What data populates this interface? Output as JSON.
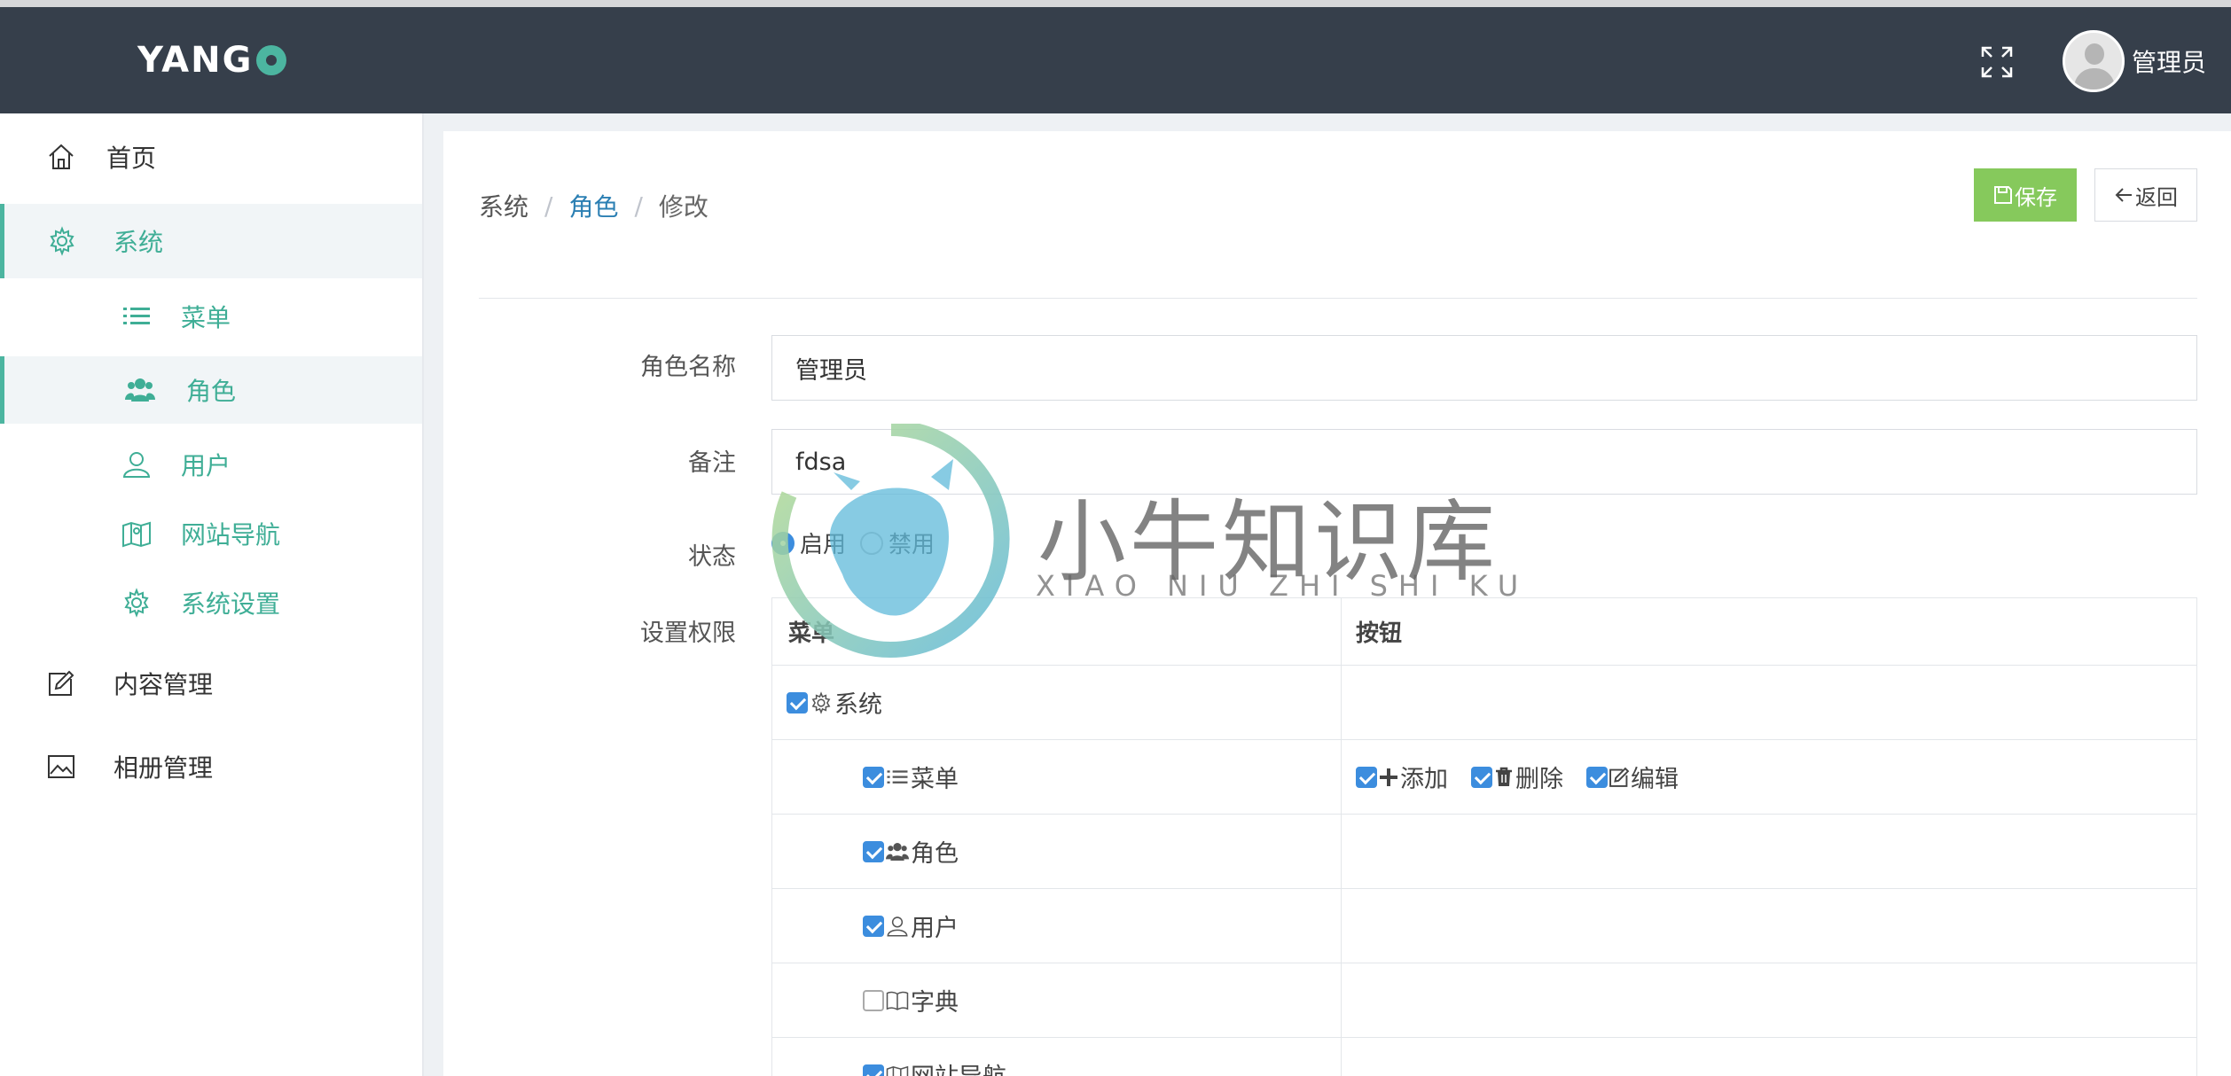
{
  "header": {
    "logo_text": "YANG",
    "user_name": "管理员"
  },
  "sidebar": {
    "items": [
      {
        "label": "首页",
        "icon": "home-icon"
      },
      {
        "label": "系统",
        "icon": "gear-icon"
      },
      {
        "label": "菜单",
        "icon": "list-icon"
      },
      {
        "label": "角色",
        "icon": "users-icon"
      },
      {
        "label": "用户",
        "icon": "user-icon"
      },
      {
        "label": "网站导航",
        "icon": "map-icon"
      },
      {
        "label": "系统设置",
        "icon": "gear-icon"
      },
      {
        "label": "内容管理",
        "icon": "edit-icon"
      },
      {
        "label": "相册管理",
        "icon": "image-icon"
      }
    ]
  },
  "breadcrumb": {
    "c1": "系统",
    "c2": "角色",
    "c3": "修改",
    "sep": "/"
  },
  "toolbar": {
    "save_label": "保存",
    "back_label": "返回"
  },
  "form": {
    "role_name_label": "角色名称",
    "role_name_value": "管理员",
    "remark_label": "备注",
    "remark_value": "fdsa",
    "status_label": "状态",
    "status_enabled": "启用",
    "status_disabled": "禁用",
    "perm_label": "设置权限"
  },
  "perm_table": {
    "col_menu": "菜单",
    "col_buttons": "按钮",
    "rows": [
      {
        "label": "系统",
        "checked": true,
        "icon": "gear-icon"
      },
      {
        "label": "菜单",
        "checked": true,
        "icon": "list-icon",
        "buttons": [
          {
            "label": "添加",
            "checked": true,
            "icon": "plus-icon"
          },
          {
            "label": "删除",
            "checked": true,
            "icon": "trash-icon"
          },
          {
            "label": "编辑",
            "checked": true,
            "icon": "edit-icon"
          }
        ]
      },
      {
        "label": "角色",
        "checked": true,
        "icon": "users-icon"
      },
      {
        "label": "用户",
        "checked": true,
        "icon": "user-icon"
      },
      {
        "label": "字典",
        "checked": false,
        "icon": "book-icon"
      },
      {
        "label": "网站导航",
        "checked": true,
        "icon": "map-icon"
      }
    ]
  },
  "watermark": {
    "title": "小牛知识库",
    "subtitle": "XIAO NIU ZHI SHI KU"
  },
  "colors": {
    "header": "#363f4b",
    "accent": "#4cb5a0",
    "save": "#86c95c",
    "link": "#2b7fb3",
    "check": "#3c8dde"
  }
}
